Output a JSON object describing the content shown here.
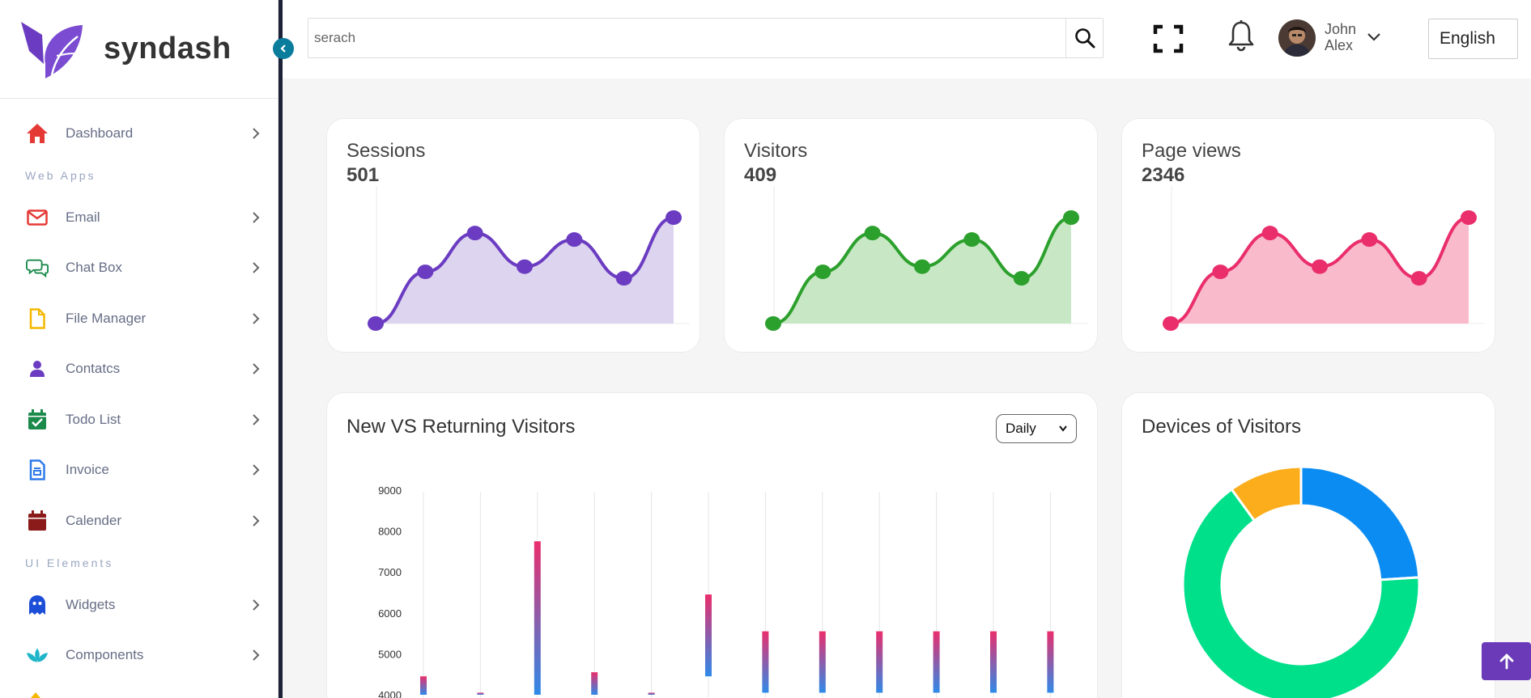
{
  "brand": {
    "name": "syndash",
    "logo_color": "#6b3cc2"
  },
  "sidebar": {
    "items": [
      {
        "label": "Dashboard",
        "icon": "home-icon",
        "color": "#e53935"
      },
      {
        "label": "Email",
        "icon": "envelope-icon",
        "color": "#e53935"
      },
      {
        "label": "Chat Box",
        "icon": "chat-icon",
        "color": "#1b8a4b"
      },
      {
        "label": "File Manager",
        "icon": "file-icon",
        "color": "#f5b800"
      },
      {
        "label": "Contatcs",
        "icon": "person-icon",
        "color": "#6b3cc2"
      },
      {
        "label": "Todo List",
        "icon": "calendar-check-icon",
        "color": "#1b8a4b"
      },
      {
        "label": "Invoice",
        "icon": "invoice-icon",
        "color": "#2f7be8"
      },
      {
        "label": "Calender",
        "icon": "calendar-icon",
        "color": "#8b1a1a"
      },
      {
        "label": "Widgets",
        "icon": "ghost-icon",
        "color": "#1d4ed8"
      },
      {
        "label": "Components",
        "icon": "lotus-icon",
        "color": "#1fb5c9"
      }
    ],
    "sections": {
      "web_apps": "Web Apps",
      "ui_elements": "UI Elements"
    }
  },
  "topbar": {
    "search_placeholder": "serach",
    "user_name": "John Alex",
    "language": "English"
  },
  "stats": [
    {
      "title": "Sessions",
      "value": "501",
      "color": "#6b3cc2",
      "fill": "#ddd4ef",
      "points": [
        0,
        40,
        70,
        44,
        65,
        35,
        82
      ]
    },
    {
      "title": "Visitors",
      "value": "409",
      "color": "#2ca02c",
      "fill": "#c8e8c5",
      "points": [
        0,
        40,
        70,
        44,
        65,
        35,
        82
      ]
    },
    {
      "title": "Page views",
      "value": "2346",
      "color": "#ea2e6c",
      "fill": "#f9bacb",
      "points": [
        0,
        40,
        70,
        44,
        65,
        35,
        82
      ]
    }
  ],
  "visitors_chart": {
    "title": "New VS Returning Visitors",
    "period": "Daily",
    "ylim": [
      4000,
      9000
    ],
    "y_ticks": [
      "9000",
      "8000",
      "7000",
      "6000",
      "5000",
      "4000"
    ],
    "bars": [
      {
        "low": 4000,
        "high": 4450
      },
      {
        "low": 4000,
        "high": 4050
      },
      {
        "low": 4000,
        "high": 7750
      },
      {
        "low": 4000,
        "high": 4550
      },
      {
        "low": 4000,
        "high": 4050
      },
      {
        "low": 4450,
        "high": 6450
      },
      {
        "low": 4050,
        "high": 5550
      },
      {
        "low": 4050,
        "high": 5550
      },
      {
        "low": 4050,
        "high": 5550
      },
      {
        "low": 4050,
        "high": 5550
      },
      {
        "low": 4050,
        "high": 5550
      },
      {
        "low": 4050,
        "high": 5550
      }
    ],
    "colors": {
      "top": "#ea2e6c",
      "bottom": "#2f8ae8"
    }
  },
  "devices_chart": {
    "title": "Devices of Visitors",
    "slices": [
      {
        "value": 24,
        "color": "#0b8cf2"
      },
      {
        "value": 66,
        "color": "#00e08a"
      },
      {
        "value": 10,
        "color": "#fbad1c"
      }
    ]
  }
}
